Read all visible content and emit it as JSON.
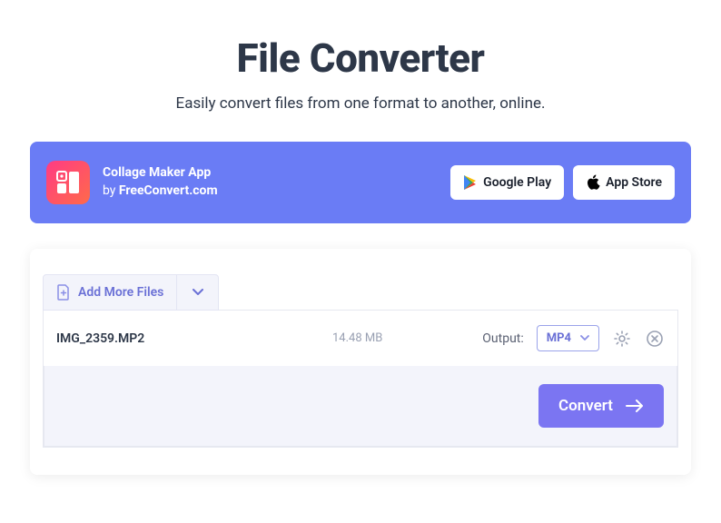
{
  "header": {
    "title": "File Converter",
    "subtitle": "Easily convert files from one format to another, online."
  },
  "promo": {
    "app_name": "Collage Maker App",
    "by_prefix": "by ",
    "brand": "FreeConvert.com",
    "google_play": "Google Play",
    "app_store": "App Store"
  },
  "uploader": {
    "add_more_label": "Add More Files"
  },
  "file": {
    "name": "IMG_2359.MP2",
    "size": "14.48 MB",
    "output_label": "Output:",
    "output_value": "MP4"
  },
  "actions": {
    "convert": "Convert"
  }
}
